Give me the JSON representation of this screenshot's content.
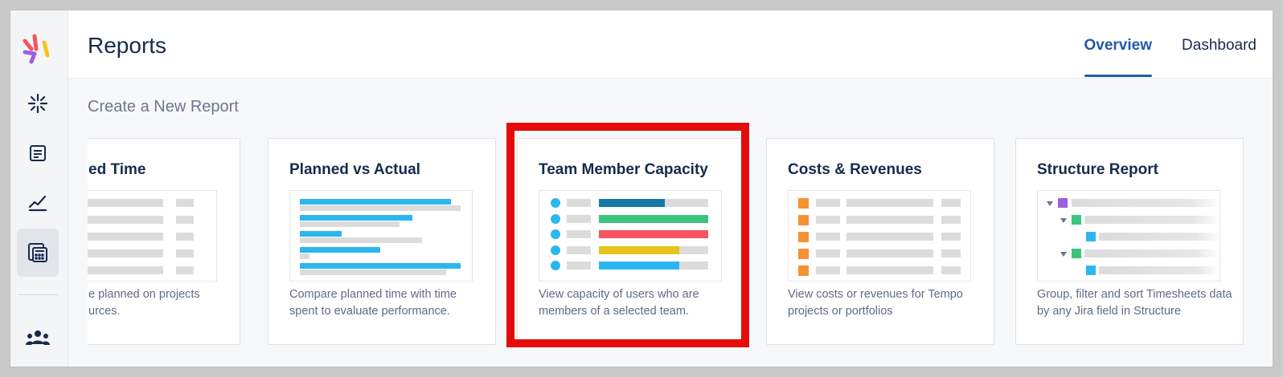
{
  "header": {
    "title": "Reports"
  },
  "tabs": [
    {
      "label": "Overview",
      "active": true
    },
    {
      "label": "Dashboard",
      "active": false
    }
  ],
  "section": {
    "title": "Create a New Report"
  },
  "cards": [
    {
      "title": "ed Time",
      "description": "e planned on projects urces."
    },
    {
      "title": "Planned vs Actual",
      "description": "Compare planned time with time spent to evaluate performance."
    },
    {
      "title": "Team Member Capacity",
      "description": "View capacity of users who are members of a selected team."
    },
    {
      "title": "Costs & Revenues",
      "description": "View costs or revenues for Tempo projects or portfolios"
    },
    {
      "title": "Structure Report",
      "description": "Group, filter and sort Timesheets data by any Jira field in Structure"
    }
  ],
  "sidebar": {
    "items": [
      {
        "icon": "tempo-logo-icon"
      },
      {
        "icon": "sparkle-icon"
      },
      {
        "icon": "timesheet-icon"
      },
      {
        "icon": "trend-chart-icon"
      },
      {
        "icon": "reports-calculator-icon",
        "active": true
      },
      {
        "icon": "teams-icon"
      }
    ]
  },
  "colors": {
    "accent": "#1f5aa8",
    "highlight": "#e60c0c",
    "blue": "#2cb6f0",
    "green": "#3cc47c",
    "red": "#f4555f",
    "yellow": "#e8c31a",
    "darkblue": "#1479a6",
    "orange": "#f79232",
    "purple": "#9f5fdc"
  }
}
